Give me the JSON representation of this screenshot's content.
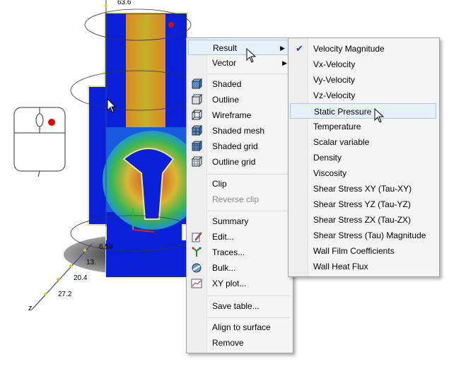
{
  "axes": {
    "top_value": "63.6",
    "values": [
      "6.59",
      "13.",
      "20.4",
      "27.2"
    ],
    "z_label": "z"
  },
  "context_menu": {
    "items": [
      {
        "label": "Result",
        "submenu": true,
        "icon": "",
        "enabled": true
      },
      {
        "label": "Vector",
        "submenu": true,
        "icon": "",
        "enabled": true
      },
      {
        "label": "Shaded",
        "icon": "shaded-cube-icon",
        "enabled": true
      },
      {
        "label": "Outline",
        "icon": "outline-cube-icon",
        "enabled": true
      },
      {
        "label": "Wireframe",
        "icon": "wireframe-cube-icon",
        "enabled": true
      },
      {
        "label": "Shaded mesh",
        "icon": "shaded-mesh-icon",
        "enabled": true
      },
      {
        "label": "Shaded grid",
        "icon": "shaded-grid-icon",
        "enabled": true
      },
      {
        "label": "Outline grid",
        "icon": "outline-grid-icon",
        "enabled": true
      },
      {
        "label": "Clip",
        "icon": "",
        "enabled": true
      },
      {
        "label": "Reverse clip",
        "icon": "",
        "enabled": false
      },
      {
        "label": "Summary",
        "icon": "",
        "enabled": true
      },
      {
        "label": "Edit...",
        "icon": "edit-icon",
        "enabled": true
      },
      {
        "label": "Traces...",
        "icon": "traces-icon",
        "enabled": true
      },
      {
        "label": "Bulk...",
        "icon": "bulk-icon",
        "enabled": true
      },
      {
        "label": "XY plot...",
        "icon": "xy-plot-icon",
        "enabled": true
      },
      {
        "label": "Save table...",
        "icon": "",
        "enabled": true
      },
      {
        "label": "Align to surface",
        "icon": "",
        "enabled": true
      },
      {
        "label": "Remove",
        "icon": "",
        "enabled": true
      }
    ]
  },
  "result_submenu": {
    "checked_item": "Velocity Magnitude",
    "hovered_item": "Static Pressure",
    "items": [
      "Velocity Magnitude",
      "Vx-Velocity",
      "Vy-Velocity",
      "Vz-Velocity",
      "Static Pressure",
      "Temperature",
      "Scalar variable",
      "Density",
      "Viscosity",
      "Shear Stress XY (Tau-XY)",
      "Shear Stress YZ (Tau-YZ)",
      "Shear Stress ZX (Tau-ZX)",
      "Shear Stress (Tau) Magnitude",
      "Wall Film Coefficients",
      "Wall Heat Flux"
    ]
  },
  "colors": {
    "low": "#0a1fd8",
    "high": "#e8a020",
    "hot": "#e02010",
    "check": "#1d3f8f",
    "highlight": "#e6f0fa"
  }
}
